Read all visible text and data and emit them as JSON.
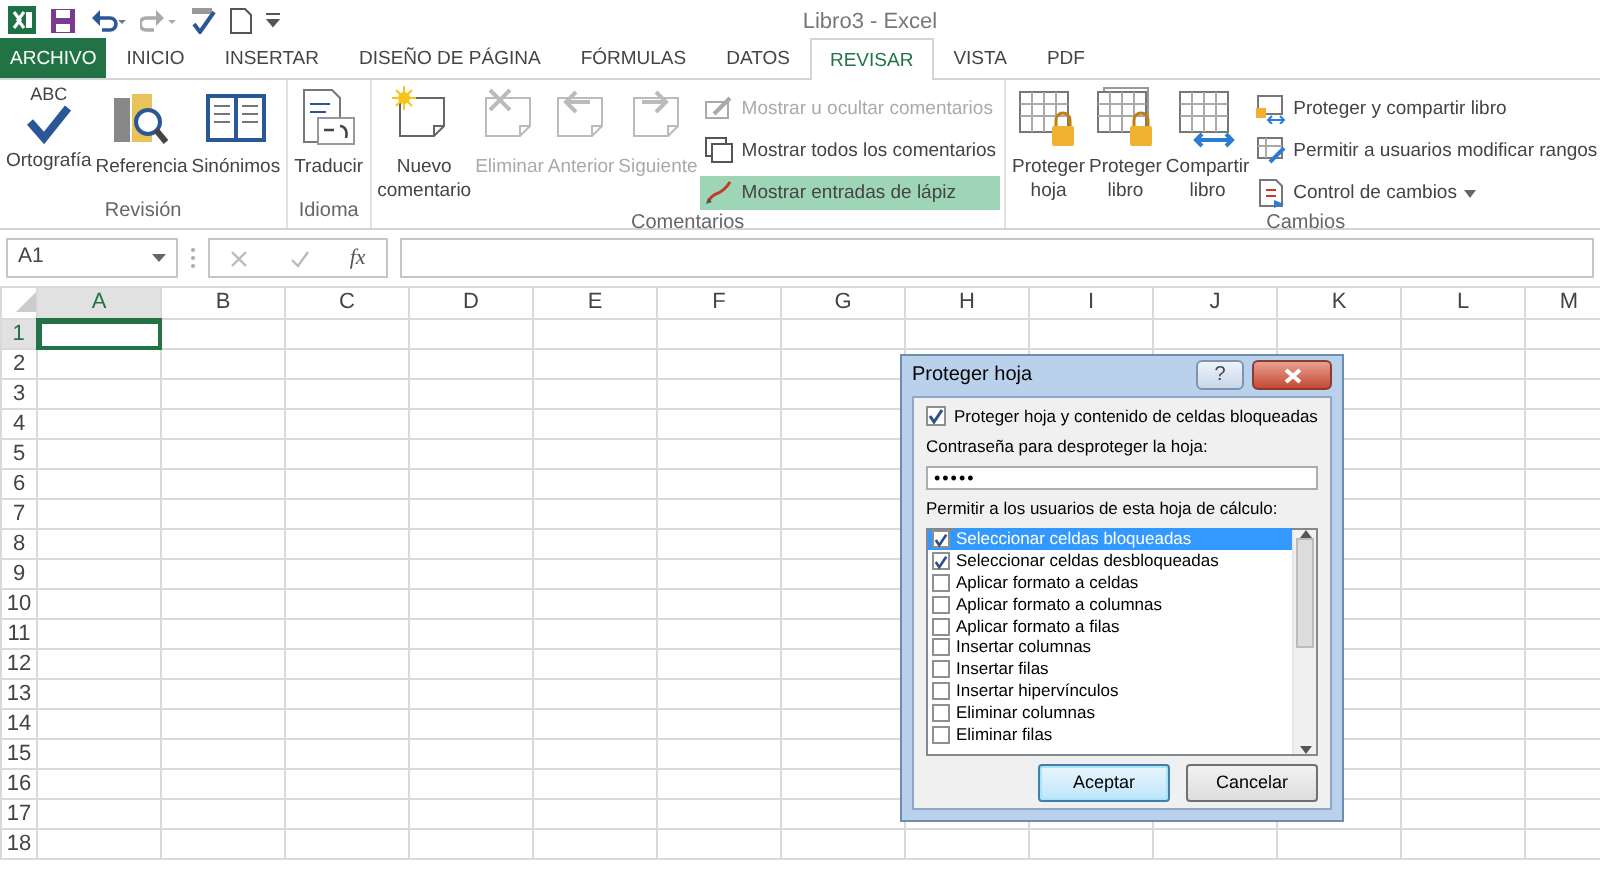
{
  "window": {
    "title": "Libro3 - Excel"
  },
  "tabs": [
    {
      "label": "ARCHIVO",
      "kind": "file",
      "selected": false
    },
    {
      "label": "INICIO",
      "kind": "tab",
      "selected": false
    },
    {
      "label": "INSERTAR",
      "kind": "tab",
      "selected": false
    },
    {
      "label": "DISEÑO DE PÁGINA",
      "kind": "tab",
      "selected": false
    },
    {
      "label": "FÓRMULAS",
      "kind": "tab",
      "selected": false
    },
    {
      "label": "DATOS",
      "kind": "tab",
      "selected": false
    },
    {
      "label": "REVISAR",
      "kind": "tab",
      "selected": true
    },
    {
      "label": "VISTA",
      "kind": "tab",
      "selected": false
    },
    {
      "label": "PDF",
      "kind": "tab",
      "selected": false
    }
  ],
  "ribbon": {
    "groups": [
      {
        "label": "Revisión",
        "buttons": [
          {
            "kind": "large",
            "label": "Ortografía",
            "icon_caption": "ABC",
            "disabled": false,
            "active": false
          },
          {
            "kind": "large",
            "label": "Referencia",
            "disabled": false,
            "active": false
          },
          {
            "kind": "large",
            "label": "Sinónimos",
            "disabled": false,
            "active": false
          }
        ]
      },
      {
        "label": "Idioma",
        "buttons": [
          {
            "kind": "large",
            "label": "Traducir",
            "disabled": false,
            "active": false
          }
        ]
      },
      {
        "label": "Comentarios",
        "buttons": [
          {
            "kind": "large",
            "label": "Nuevo comentario",
            "disabled": false,
            "active": false
          },
          {
            "kind": "large",
            "label": "Eliminar",
            "disabled": true,
            "active": false
          },
          {
            "kind": "large",
            "label": "Anterior",
            "disabled": true,
            "active": false
          },
          {
            "kind": "large",
            "label": "Siguiente",
            "disabled": true,
            "active": false
          },
          {
            "kind": "small",
            "label": "Mostrar u ocultar comentarios",
            "disabled": true,
            "active": false
          },
          {
            "kind": "small",
            "label": "Mostrar todos los comentarios",
            "disabled": false,
            "active": false
          },
          {
            "kind": "small",
            "label": "Mostrar entradas de lápiz",
            "disabled": false,
            "active": true
          }
        ]
      },
      {
        "label": "Cambios",
        "buttons": [
          {
            "kind": "large",
            "label": "Proteger hoja",
            "disabled": false,
            "active": false
          },
          {
            "kind": "large",
            "label": "Proteger libro",
            "disabled": false,
            "active": false
          },
          {
            "kind": "large",
            "label": "Compartir libro",
            "disabled": false,
            "active": false
          },
          {
            "kind": "small",
            "label": "Proteger y compartir libro",
            "disabled": false,
            "active": false
          },
          {
            "kind": "small",
            "label": "Permitir a usuarios modificar rangos",
            "disabled": false,
            "active": false
          },
          {
            "kind": "small",
            "label": "Control de cambios",
            "disabled": false,
            "active": false,
            "dropdown": true
          }
        ]
      }
    ]
  },
  "formula_bar": {
    "name_box": "A1",
    "function_label": "fx"
  },
  "sheet": {
    "columns": [
      {
        "label": "A",
        "selected": true
      },
      {
        "label": "B",
        "selected": false
      },
      {
        "label": "C",
        "selected": false
      },
      {
        "label": "D",
        "selected": false
      },
      {
        "label": "E",
        "selected": false
      },
      {
        "label": "F",
        "selected": false
      },
      {
        "label": "G",
        "selected": false
      },
      {
        "label": "H",
        "selected": false
      },
      {
        "label": "I",
        "selected": false
      },
      {
        "label": "J",
        "selected": false
      },
      {
        "label": "K",
        "selected": false
      },
      {
        "label": "L",
        "selected": false
      },
      {
        "label": "M",
        "selected": false
      }
    ],
    "rows": [
      {
        "label": "1",
        "selected": true
      },
      {
        "label": "2",
        "selected": false
      },
      {
        "label": "3",
        "selected": false
      },
      {
        "label": "4",
        "selected": false
      },
      {
        "label": "5",
        "selected": false
      },
      {
        "label": "6",
        "selected": false
      },
      {
        "label": "7",
        "selected": false
      },
      {
        "label": "8",
        "selected": false
      },
      {
        "label": "9",
        "selected": false
      },
      {
        "label": "10",
        "selected": false
      },
      {
        "label": "11",
        "selected": false
      },
      {
        "label": "12",
        "selected": false
      },
      {
        "label": "13",
        "selected": false
      },
      {
        "label": "14",
        "selected": false
      },
      {
        "label": "15",
        "selected": false
      },
      {
        "label": "16",
        "selected": false
      },
      {
        "label": "17",
        "selected": false
      },
      {
        "label": "18",
        "selected": false
      }
    ]
  },
  "dialog": {
    "title": "Proteger hoja",
    "help_button": "?",
    "protect_checkbox": {
      "label": "Proteger hoja y contenido de celdas bloqueadas",
      "checked": true
    },
    "password_label": "Contraseña para desproteger la hoja:",
    "password_value": "•••••",
    "list_label": "Permitir a los usuarios de esta hoja de cálculo:",
    "options": [
      {
        "label": "Seleccionar celdas bloqueadas",
        "checked": true,
        "selected": true
      },
      {
        "label": "Seleccionar celdas desbloqueadas",
        "checked": true,
        "selected": false
      },
      {
        "label": "Aplicar formato a celdas",
        "checked": false,
        "selected": false
      },
      {
        "label": "Aplicar formato a columnas",
        "checked": false,
        "selected": false
      },
      {
        "label": "Aplicar formato a filas",
        "checked": false,
        "selected": false
      },
      {
        "label": "Insertar columnas",
        "checked": false,
        "selected": false
      },
      {
        "label": "Insertar filas",
        "checked": false,
        "selected": false
      },
      {
        "label": "Insertar hipervínculos",
        "checked": false,
        "selected": false
      },
      {
        "label": "Eliminar columnas",
        "checked": false,
        "selected": false
      },
      {
        "label": "Eliminar filas",
        "checked": false,
        "selected": false
      }
    ],
    "buttons": [
      {
        "label": "Aceptar",
        "kind": "default"
      },
      {
        "label": "Cancelar",
        "kind": "normal"
      }
    ]
  }
}
